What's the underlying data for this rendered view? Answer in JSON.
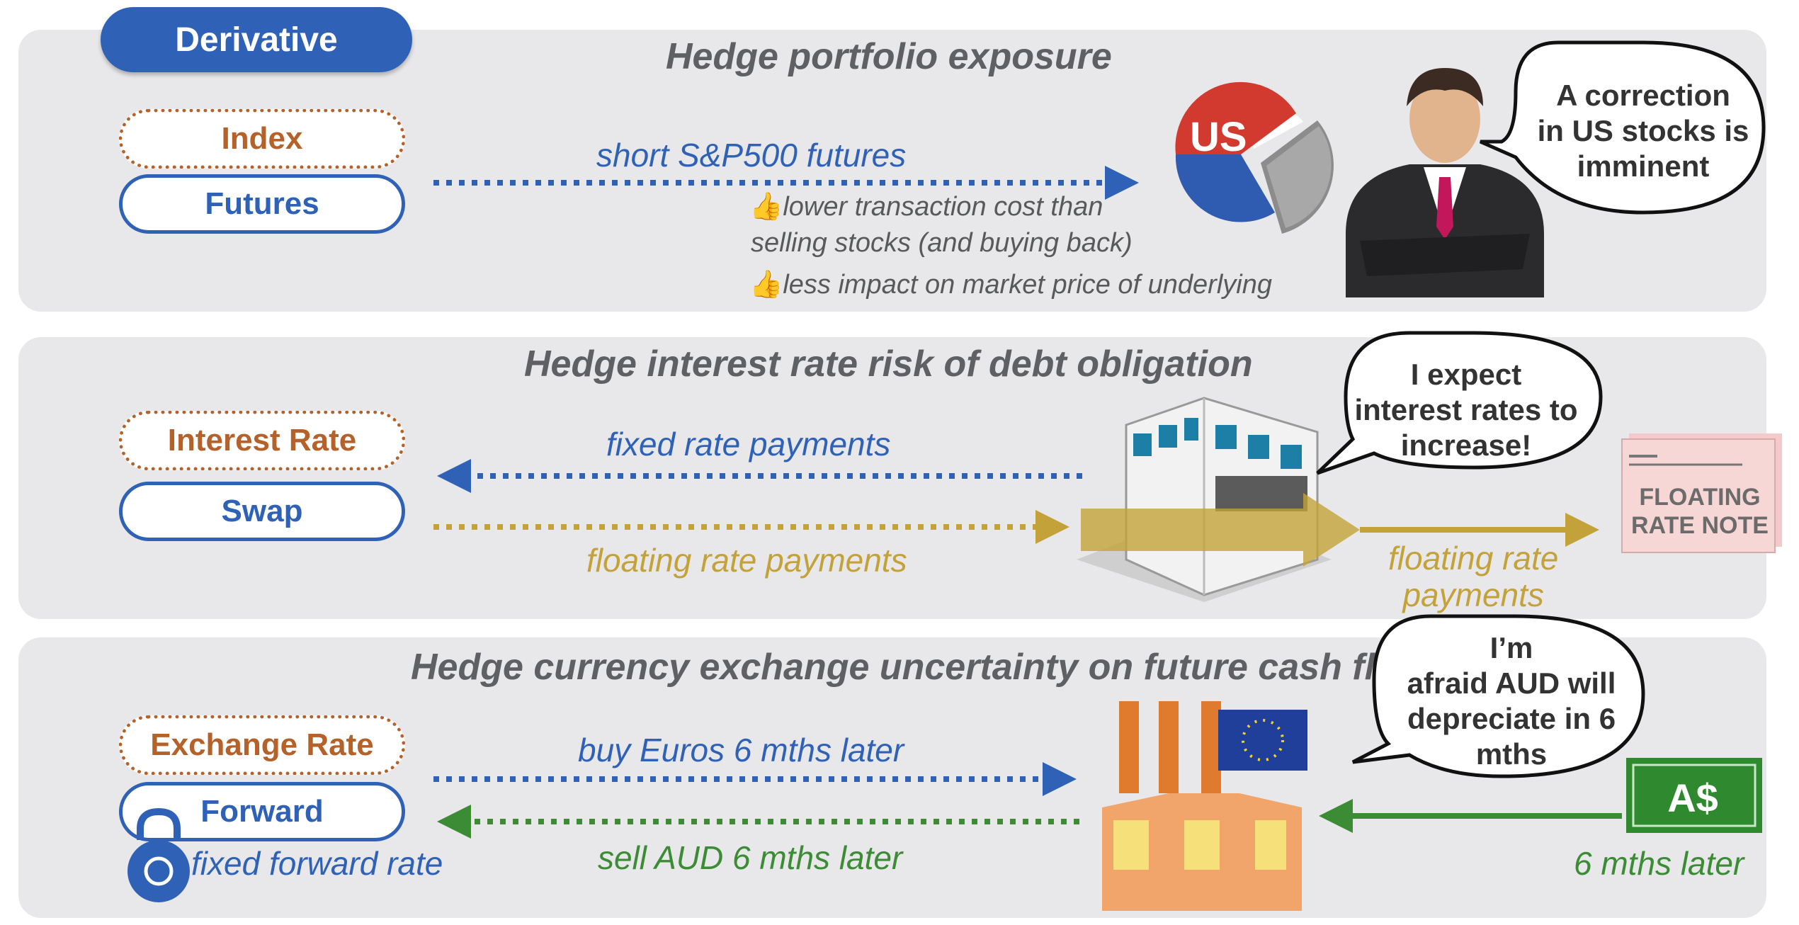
{
  "badge": "Derivative",
  "sections": [
    {
      "title": "Hedge portfolio exposure",
      "pill_top": "Index",
      "pill_bottom": "Futures",
      "arrow_label": "short S&P500 futures",
      "notes": [
        "lower transaction cost than",
        "selling stocks (and buying back)",
        "less impact on market price of underlying"
      ],
      "pie_label": "US",
      "bubble": [
        "A correction",
        "in US stocks is",
        "imminent"
      ]
    },
    {
      "title": "Hedge interest rate risk of debt obligation",
      "pill_top": "Interest Rate",
      "pill_bottom": "Swap",
      "arrow_label_top": "fixed rate payments",
      "arrow_label_bottom": "floating rate payments",
      "right_label": [
        "floating rate",
        "payments"
      ],
      "note_doc": [
        "FLOATING",
        "RATE NOTE"
      ],
      "bubble": [
        "I expect",
        "interest rates to",
        "increase!"
      ]
    },
    {
      "title": "Hedge currency exchange uncertainty on future cash flows",
      "pill_top": "Exchange Rate",
      "pill_bottom": "Forward",
      "lock_label": "fixed forward rate",
      "arrow_label_top": "buy Euros 6 mths later",
      "arrow_label_bottom": "sell AUD 6 mths later",
      "right_label": "6 mths later",
      "cash_label": "A$",
      "bubble": [
        "I’m",
        "afraid AUD will",
        "depreciate in 6",
        "mths"
      ]
    }
  ],
  "colors": {
    "blue": "#2f62b6",
    "orange": "#b5622a",
    "gold": "#c4a23a",
    "green": "#3c8b35",
    "panel": "#e8e8ea"
  }
}
